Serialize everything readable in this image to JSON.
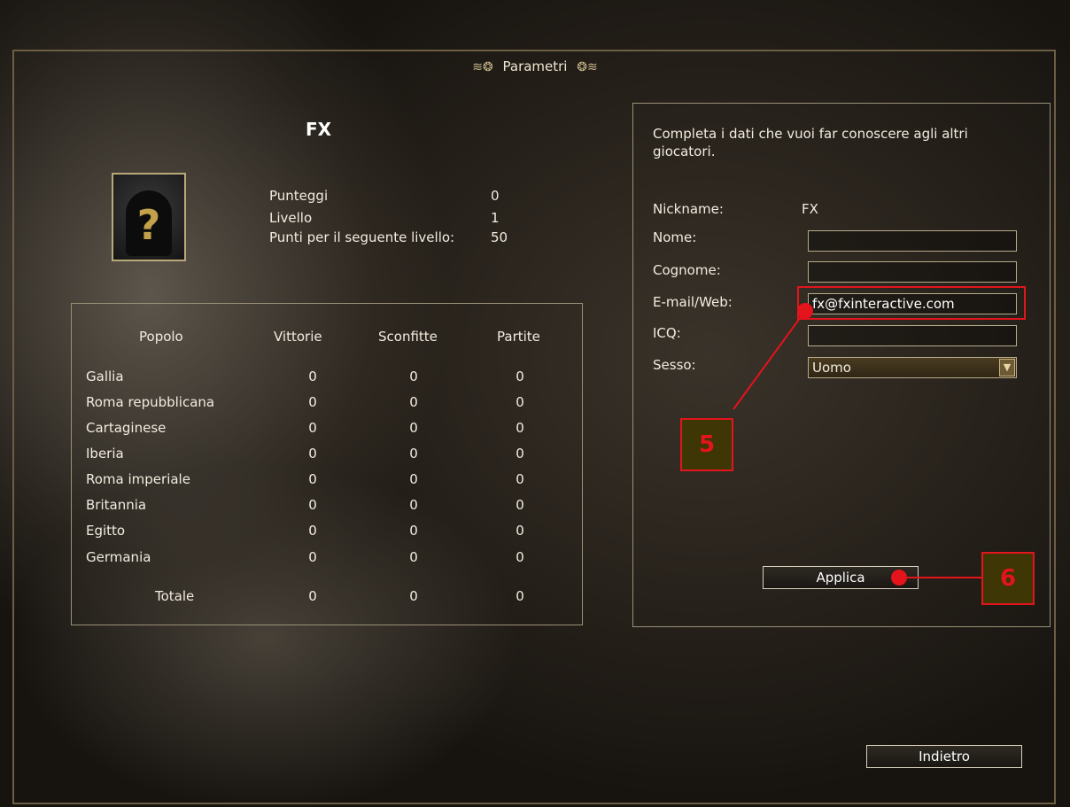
{
  "window": {
    "title": "Parametri"
  },
  "player": {
    "name": "FX"
  },
  "stats": [
    {
      "label": "Punteggi",
      "value": "0"
    },
    {
      "label": "Livello",
      "value": "1"
    },
    {
      "label": "Punti per il seguente livello:",
      "value": "50"
    }
  ],
  "table": {
    "headers": [
      "Popolo",
      "Vittorie",
      "Sconfitte",
      "Partite"
    ],
    "rows": [
      {
        "popolo": "Gallia",
        "vittorie": "0",
        "sconfitte": "0",
        "partite": "0"
      },
      {
        "popolo": "Roma repubblicana",
        "vittorie": "0",
        "sconfitte": "0",
        "partite": "0"
      },
      {
        "popolo": "Cartaginese",
        "vittorie": "0",
        "sconfitte": "0",
        "partite": "0"
      },
      {
        "popolo": "Iberia",
        "vittorie": "0",
        "sconfitte": "0",
        "partite": "0"
      },
      {
        "popolo": "Roma imperiale",
        "vittorie": "0",
        "sconfitte": "0",
        "partite": "0"
      },
      {
        "popolo": "Britannia",
        "vittorie": "0",
        "sconfitte": "0",
        "partite": "0"
      },
      {
        "popolo": "Egitto",
        "vittorie": "0",
        "sconfitte": "0",
        "partite": "0"
      },
      {
        "popolo": "Germania",
        "vittorie": "0",
        "sconfitte": "0",
        "partite": "0"
      }
    ],
    "total": {
      "label": "Totale",
      "vittorie": "0",
      "sconfitte": "0",
      "partite": "0"
    }
  },
  "form": {
    "intro": "Completa i dati che vuoi far conoscere agli altri giocatori.",
    "nickname_label": "Nickname:",
    "nickname_value": "FX",
    "nome_label": "Nome:",
    "nome_value": "",
    "cognome_label": "Cognome:",
    "cognome_value": "",
    "email_label": "E-mail/Web:",
    "email_value": "fx@fxinteractive.com",
    "icq_label": "ICQ:",
    "icq_value": "",
    "sesso_label": "Sesso:",
    "sesso_value": "Uomo",
    "apply_label": "Applica"
  },
  "back_label": "Indietro",
  "callouts": {
    "five": "5",
    "six": "6"
  },
  "colors": {
    "annotation": "#e3141b",
    "callout_fill": "#3e3605"
  }
}
